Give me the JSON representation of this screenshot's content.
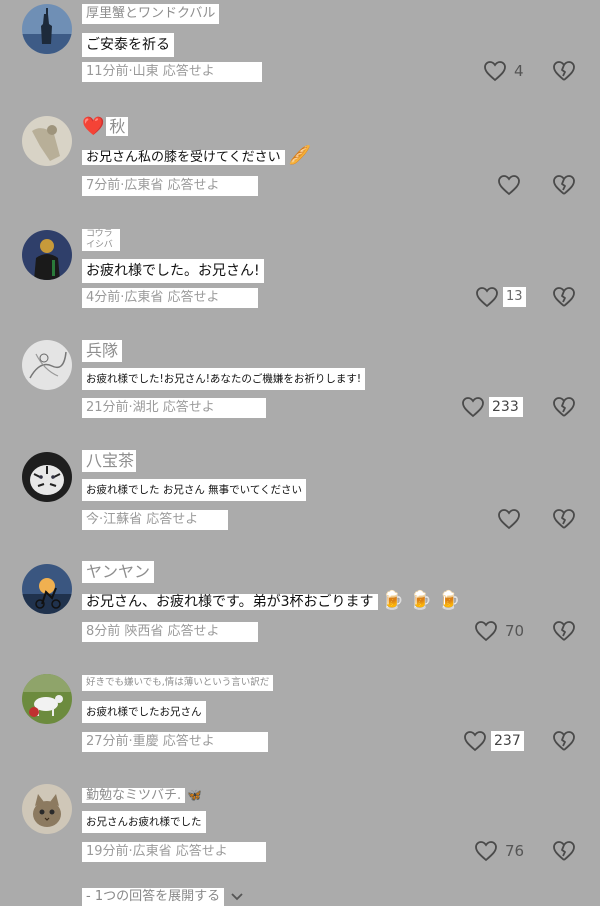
{
  "comments": [
    {
      "username": "厚里蟹とワンドクバル",
      "text": "ご安泰を祈る",
      "meta": "11分前·山東 応答せよ",
      "likes": "4",
      "avatar_icon": "statue-of-liberty-avatar"
    },
    {
      "username_emoji": "❤️",
      "username": "秋",
      "text": "お兄さん私の膝を受けてください",
      "text_emoji": "🥖",
      "meta": "7分前·広東省 応答せよ",
      "likes": "",
      "avatar_icon": "sketch-figure-avatar"
    },
    {
      "username": "コウライシバ",
      "text": "お疲れ様でした。お兄さん!",
      "meta": "4分前·広東省 応答せよ",
      "likes": "13",
      "avatar_icon": "person-back-avatar"
    },
    {
      "username": "兵隊",
      "text": "お疲れ様でした!お兄さん!あなたのご機嫌をお祈りします!",
      "meta": "21分前·湖北 応答せよ",
      "likes": "233",
      "avatar_icon": "ink-drawing-avatar"
    },
    {
      "username": "八宝茶",
      "text": "お疲れ様でした お兄さん 無事でいてください",
      "meta": "今·江蘇省 応答せよ",
      "likes": "",
      "avatar_icon": "white-tiger-avatar"
    },
    {
      "username": "ヤンヤン",
      "text": "お兄さん、お疲れ様です。弟が3杯おごります",
      "text_emoji": "🍺🍺🍺",
      "meta": "8分前 陝西省 応答せよ",
      "likes": "70",
      "avatar_icon": "sunset-cyclist-avatar"
    },
    {
      "username": "好きでも嫌いでも,情は薄いという言い訳だ",
      "text": "お疲れ様でしたお兄さん",
      "meta": "27分前·重慶 応答せよ",
      "likes": "237",
      "avatar_icon": "goat-field-avatar"
    },
    {
      "username": "勤勉なミツバチ.",
      "username_emoji": "🦋",
      "text": "お兄さんお疲れ様でした",
      "meta": "19分前·広東省 応答せよ",
      "likes": "76",
      "avatar_icon": "cat-avatar"
    }
  ],
  "expand_replies_label": "- 1つの回答を展開する",
  "icons": {
    "like": "heart-outline-icon",
    "dislike": "broken-heart-icon",
    "expand": "chevron-down-icon"
  },
  "colors": {
    "background": "#ababab",
    "icon": "#4a4a4a",
    "meta_text": "#9a9a9a"
  }
}
